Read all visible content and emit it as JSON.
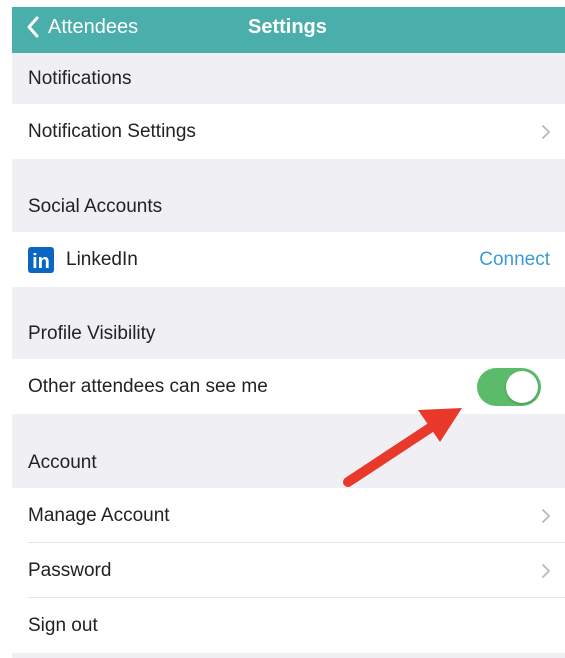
{
  "colors": {
    "nav_bar": "#4aaeaa",
    "accent_link": "#3b9bd8",
    "toggle_on": "#5cbb6a",
    "linkedin_blue": "#0a66c2",
    "annotation_arrow": "#e8392b"
  },
  "nav": {
    "back_icon": "chevron-left-icon",
    "back_label": "Attendees",
    "title": "Settings"
  },
  "sections": {
    "notifications": {
      "header": "Notifications",
      "rows": [
        {
          "label": "Notification Settings",
          "icon": "chevron-right-icon"
        }
      ]
    },
    "social": {
      "header": "Social Accounts",
      "linkedin": {
        "logo_text": "in",
        "icon": "linkedin-icon",
        "label": "LinkedIn",
        "action": "Connect"
      }
    },
    "visibility": {
      "header": "Profile Visibility",
      "toggle_row": {
        "label": "Other attendees can see me",
        "toggle_state": "on"
      }
    },
    "account": {
      "header": "Account",
      "rows": [
        {
          "label": "Manage Account",
          "icon": "chevron-right-icon"
        },
        {
          "label": "Password",
          "icon": "chevron-right-icon"
        },
        {
          "label": "Sign out"
        }
      ]
    }
  },
  "annotation": {
    "icon": "red-arrow-icon",
    "points_to": "visibility-toggle"
  }
}
